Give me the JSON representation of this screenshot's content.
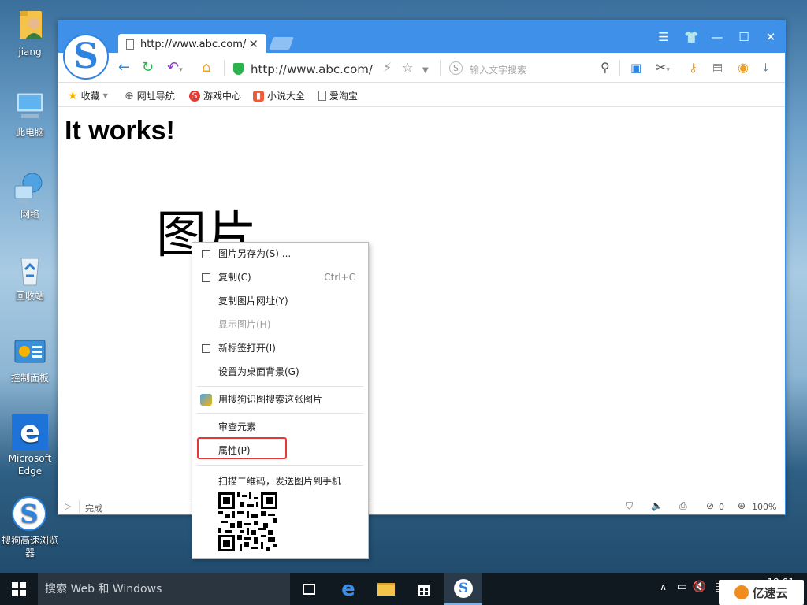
{
  "desktop": {
    "icons": [
      {
        "label": "jiang"
      },
      {
        "label": "此电脑"
      },
      {
        "label": "网络"
      },
      {
        "label": "回收站"
      },
      {
        "label": "控制面板"
      },
      {
        "label": "Microsoft Edge"
      },
      {
        "label": "搜狗高速浏览器"
      }
    ]
  },
  "browser": {
    "tab_title": "http://www.abc.com/",
    "tab_close": "✕",
    "address": "http://www.abc.com/",
    "search_placeholder": "输入文字搜索",
    "bookmarks": [
      "收藏",
      "网址导航",
      "游戏中心",
      "小说大全",
      "爱淘宝"
    ],
    "status_text": "完成",
    "status_count": "0",
    "zoom": "100%"
  },
  "page": {
    "heading": "It works!",
    "image_text": "图片"
  },
  "context_menu": {
    "items": [
      {
        "label": "图片另存为(S) ...",
        "shortcut": ""
      },
      {
        "label": "复制(C)",
        "shortcut": "Ctrl+C"
      },
      {
        "label": "复制图片网址(Y)",
        "shortcut": ""
      },
      {
        "label": "显示图片(H)",
        "shortcut": ""
      },
      {
        "label": "新标签打开(I)",
        "shortcut": ""
      },
      {
        "label": "设置为桌面背景(G)",
        "shortcut": ""
      },
      {
        "label": "用搜狗识图搜索这张图片",
        "shortcut": ""
      },
      {
        "label": "审查元素",
        "shortcut": ""
      },
      {
        "label": "属性(P)",
        "shortcut": ""
      },
      {
        "label": "扫描二维码，发送图片到手机",
        "shortcut": ""
      }
    ],
    "highlight_color": "#e53935"
  },
  "taskbar": {
    "search_placeholder": "搜索 Web 和 Windows",
    "time": "18:01"
  },
  "watermark": {
    "text": "亿速云"
  }
}
